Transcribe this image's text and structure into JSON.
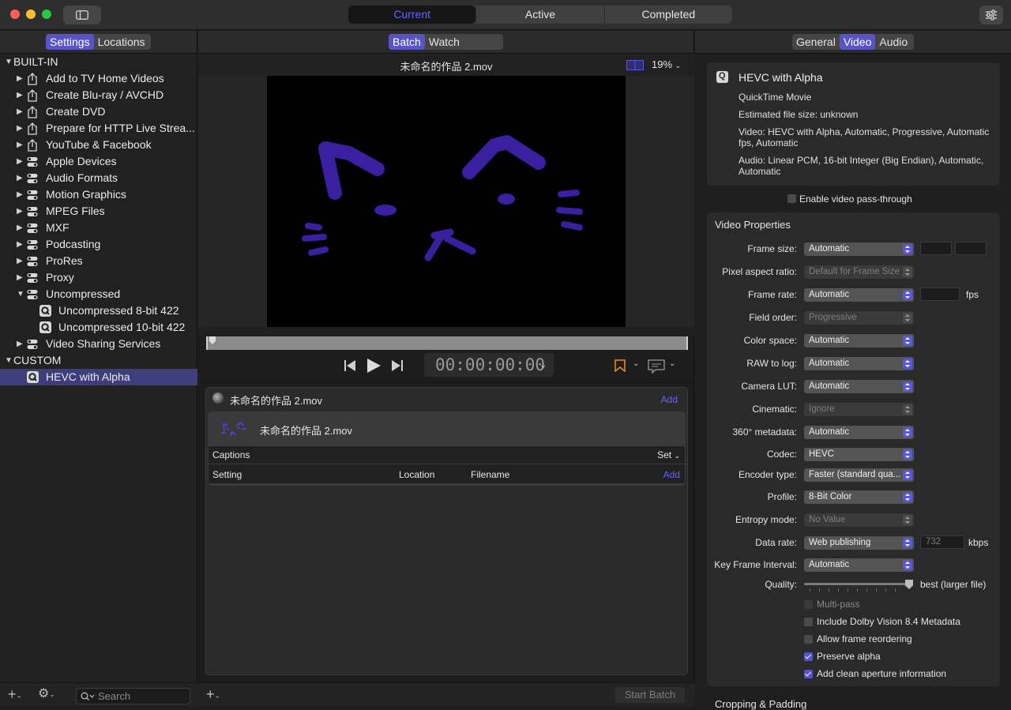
{
  "toolbar": {
    "tabs": [
      "Current",
      "Active",
      "Completed"
    ],
    "selected_tab": "Current"
  },
  "left": {
    "tabs": [
      "Settings",
      "Locations"
    ],
    "sections": [
      {
        "label": "BUILT-IN",
        "items": [
          {
            "label": "Add to TV Home Videos",
            "icon": "share-icon"
          },
          {
            "label": "Create Blu-ray / AVCHD",
            "icon": "share-icon"
          },
          {
            "label": "Create DVD",
            "icon": "share-icon"
          },
          {
            "label": "Prepare for HTTP Live Strea...",
            "icon": "share-icon"
          },
          {
            "label": "YouTube & Facebook",
            "icon": "share-icon"
          },
          {
            "label": "Apple Devices",
            "icon": "group-icon"
          },
          {
            "label": "Audio Formats",
            "icon": "group-icon"
          },
          {
            "label": "Motion Graphics",
            "icon": "group-icon"
          },
          {
            "label": "MPEG Files",
            "icon": "group-icon"
          },
          {
            "label": "MXF",
            "icon": "group-icon"
          },
          {
            "label": "Podcasting",
            "icon": "group-icon"
          },
          {
            "label": "ProRes",
            "icon": "group-icon"
          },
          {
            "label": "Proxy",
            "icon": "group-icon"
          },
          {
            "label": "Uncompressed",
            "icon": "group-icon",
            "children": [
              "Uncompressed 8-bit 422",
              "Uncompressed 10-bit 422"
            ]
          },
          {
            "label": "Video Sharing Services",
            "icon": "group-icon"
          }
        ]
      },
      {
        "label": "CUSTOM",
        "items": [
          {
            "label": "HEVC with Alpha",
            "icon": "quicktime-icon",
            "selected": true
          }
        ]
      }
    ],
    "search_placeholder": "Search"
  },
  "center": {
    "tabs": [
      "Batch",
      "Watch Folders"
    ],
    "preview_title": "未命名的作品 2.mov",
    "zoom": "19%",
    "timecode": "00:00:00:00",
    "batch": {
      "file": "未命名的作品 2.mov",
      "add": "Add",
      "job_name": "未命名的作品 2.mov",
      "captions_label": "Captions",
      "set_label": "Set",
      "columns": [
        "Setting",
        "Location",
        "Filename"
      ],
      "add2": "Add"
    },
    "start_batch": "Start Batch"
  },
  "right": {
    "tabs": [
      "General",
      "Video",
      "Audio"
    ],
    "selected_tab": "Video",
    "summary": {
      "title": "HEVC with Alpha",
      "format": "QuickTime Movie",
      "estimated_size": "Estimated file size: unknown",
      "video": "Video: HEVC with Alpha, Automatic, Progressive, Automatic fps, Automatic",
      "audio": "Audio: Linear PCM, 16-bit Integer (Big Endian), Automatic, Automatic"
    },
    "passthrough_label": "Enable video pass-through",
    "video_properties_title": "Video Properties",
    "props": {
      "frame_size": {
        "label": "Frame size:",
        "value": "Automatic"
      },
      "pixel_aspect": {
        "label": "Pixel aspect ratio:",
        "value": "Default for Frame Size"
      },
      "frame_rate": {
        "label": "Frame rate:",
        "value": "Automatic",
        "unit": "fps"
      },
      "field_order": {
        "label": "Field order:",
        "value": "Progressive"
      },
      "color_space": {
        "label": "Color space:",
        "value": "Automatic"
      },
      "raw_to_log": {
        "label": "RAW to log:",
        "value": "Automatic"
      },
      "camera_lut": {
        "label": "Camera LUT:",
        "value": "Automatic"
      },
      "cinematic": {
        "label": "Cinematic:",
        "value": "Ignore"
      },
      "metadata_360": {
        "label": "360° metadata:",
        "value": "Automatic"
      },
      "codec": {
        "label": "Codec:",
        "value": "HEVC"
      },
      "encoder_type": {
        "label": "Encoder type:",
        "value": "Faster (standard qua..."
      },
      "profile": {
        "label": "Profile:",
        "value": "8-Bit Color"
      },
      "entropy_mode": {
        "label": "Entropy mode:",
        "value": "No Value"
      },
      "data_rate": {
        "label": "Data rate:",
        "value": "Web publishing",
        "kbps": "732",
        "unit": "kbps"
      },
      "key_frame": {
        "label": "Key Frame Interval:",
        "value": "Automatic"
      },
      "quality": {
        "label": "Quality:",
        "right_label": "best (larger file)",
        "level": 1.0
      }
    },
    "checkboxes": [
      {
        "label": "Multi-pass",
        "checked": false,
        "disabled": true
      },
      {
        "label": "Include Dolby Vision 8.4 Metadata",
        "checked": false,
        "disabled": false
      },
      {
        "label": "Allow frame reordering",
        "checked": false,
        "disabled": false
      },
      {
        "label": "Preserve alpha",
        "checked": true,
        "disabled": false
      },
      {
        "label": "Add clean aperture information",
        "checked": true,
        "disabled": false
      }
    ],
    "cropping_title": "Cropping & Padding"
  },
  "colors": {
    "accent": "#5854c5",
    "segment_text": "#6a63ff",
    "drawing": "#3a1fa0"
  }
}
